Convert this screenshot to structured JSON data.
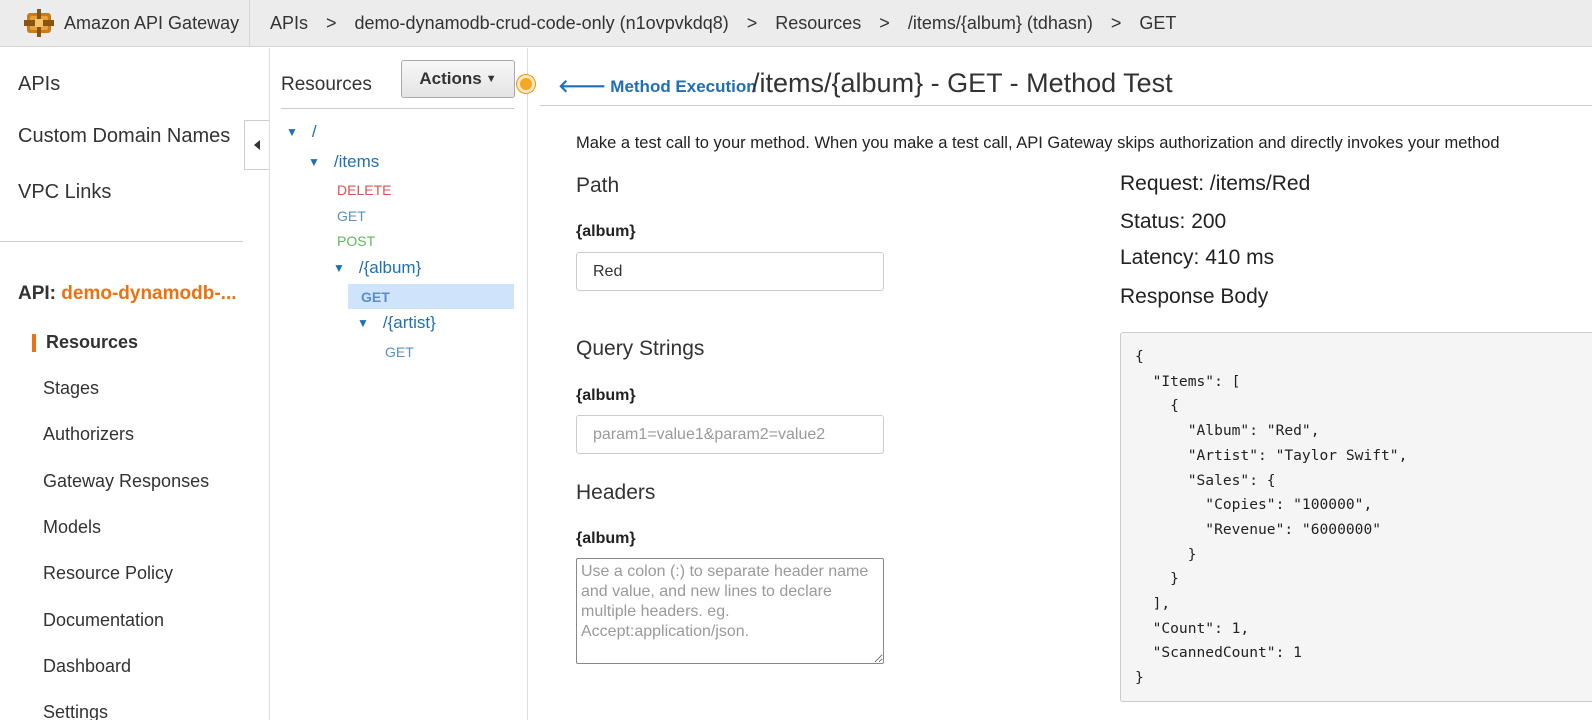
{
  "topbar": {
    "brand": "Amazon API Gateway",
    "breadcrumbs": [
      "APIs",
      "demo-dynamodb-crud-code-only (n1ovpvkdq8)",
      "Resources",
      "/items/{album} (tdhasn)",
      "GET"
    ],
    "separator": ">"
  },
  "leftnav": {
    "top_items": [
      "APIs",
      "Custom Domain Names",
      "VPC Links"
    ],
    "api_prefix": "API:",
    "api_name": "demo-dynamodb-...",
    "sub_items": [
      "Resources",
      "Stages",
      "Authorizers",
      "Gateway Responses",
      "Models",
      "Resource Policy",
      "Documentation",
      "Dashboard",
      "Settings"
    ],
    "active_item": "Resources"
  },
  "resources": {
    "title": "Resources",
    "actions_label": "Actions",
    "tree": {
      "root": "/",
      "items": "/items",
      "items_methods": [
        "DELETE",
        "GET",
        "POST"
      ],
      "album": "/{album}",
      "album_method": "GET",
      "artist": "/{artist}",
      "artist_method": "GET"
    }
  },
  "main": {
    "back_link": "Method Execution",
    "title": "/items/{album} - GET - Method Test",
    "intro": "Make a test call to your method. When you make a test call, API Gateway skips authorization and directly invokes your method",
    "path_section": "Path",
    "path_label": "{album}",
    "path_value": "Red",
    "query_section": "Query Strings",
    "query_label": "{album}",
    "query_placeholder": "param1=value1&param2=value2",
    "headers_section": "Headers",
    "headers_label": "{album}",
    "headers_placeholder": "Use a colon (:) to separate header name and value, and new lines to declare multiple headers. eg. Accept:application/json."
  },
  "response": {
    "request": "Request: /items/Red",
    "status": "Status: 200",
    "latency": "Latency: 410 ms",
    "body_title": "Response Body",
    "body": "{\n  \"Items\": [\n    {\n      \"Album\": \"Red\",\n      \"Artist\": \"Taylor Swift\",\n      \"Sales\": {\n        \"Copies\": \"100000\",\n        \"Revenue\": \"6000000\"\n      }\n    }\n  ],\n  \"Count\": 1,\n  \"ScannedCount\": 1\n}"
  },
  "colors": {
    "accent": "#ec7211",
    "link": "#1f6fb5",
    "delete": "#d9534f",
    "post": "#5cb85c",
    "get": "#5b8ec7"
  }
}
